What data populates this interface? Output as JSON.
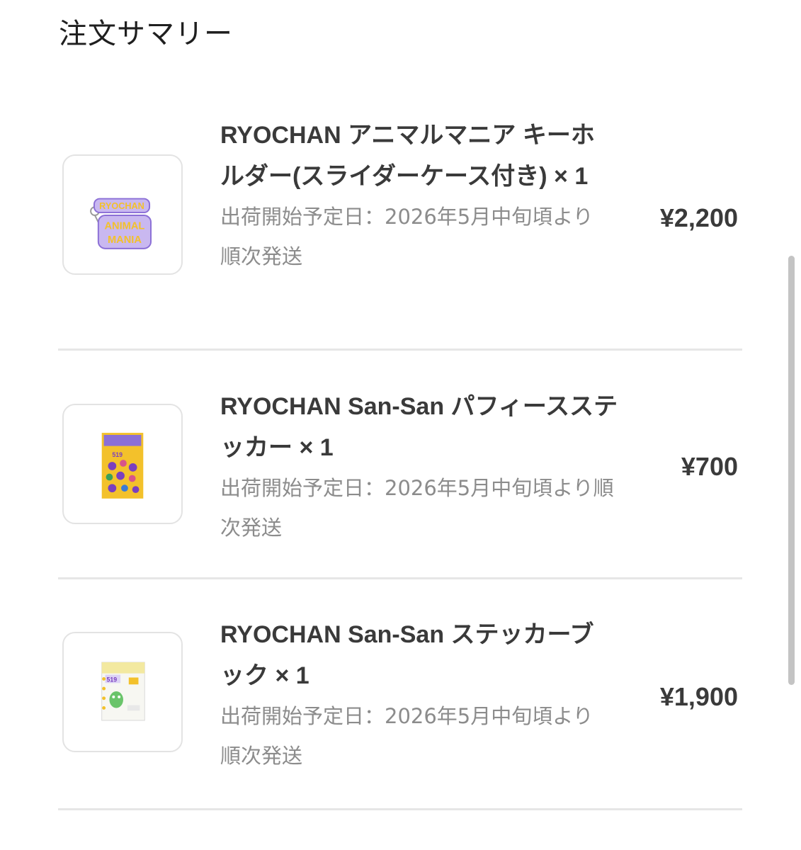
{
  "page": {
    "title": "注文サマリー"
  },
  "items": [
    {
      "name": "RYOCHAN アニマルマニア キーホルダー(スライダーケース付き) × 1",
      "shipping": "出荷開始予定日：2026年5月中旬頃より順次発送",
      "price": "¥2,200",
      "thumbnail": {
        "line1": "RYOCHAN",
        "line2": "ANIMAL",
        "line3": "MANIA"
      }
    },
    {
      "name": "RYOCHAN San-San パフィースステッカー × 1",
      "shipping": "出荷開始予定日：2026年5月中旬頃より順次発送",
      "price": "¥700",
      "thumbnail": {
        "label": "519"
      }
    },
    {
      "name": "RYOCHAN San-San ステッカーブック × 1",
      "shipping": "出荷開始予定日：2026年5月中旬頃より順次発送",
      "price": "¥1,900",
      "thumbnail": {
        "label": "519"
      }
    }
  ],
  "colors": {
    "accent_purple": "#8b6fd6",
    "sticker_yellow": "#f3c12b",
    "text_dark": "#3a3a3a",
    "text_muted": "#8c8c8c",
    "divider": "#e6e6e6"
  }
}
